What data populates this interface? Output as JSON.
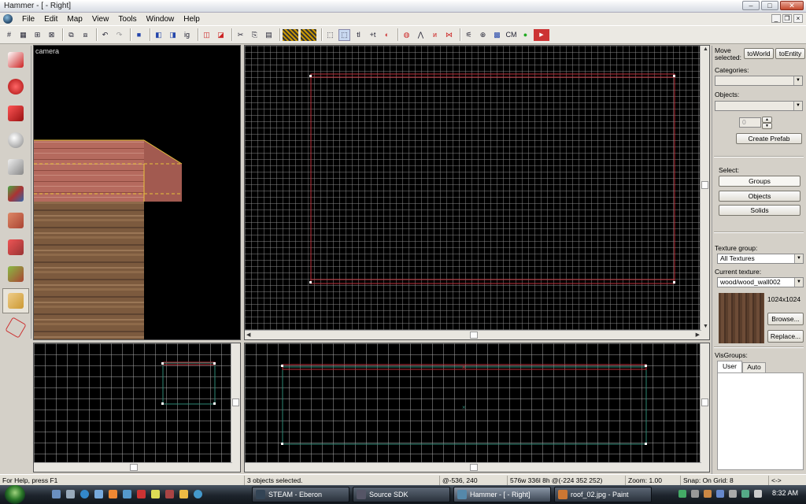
{
  "window": {
    "title": "Hammer - [ - Right]"
  },
  "menu": {
    "items": [
      "File",
      "Edit",
      "Map",
      "View",
      "Tools",
      "Window",
      "Help"
    ]
  },
  "toolbar": {
    "cm_label": "CM"
  },
  "viewports": {
    "camera_label": "camera"
  },
  "right_panel": {
    "move_selected_label": "Move selected:",
    "to_world": "toWorld",
    "to_entity": "toEntity",
    "categories_label": "Categories:",
    "objects_label": "Objects:",
    "count_value": "0",
    "create_prefab": "Create Prefab",
    "select_label": "Select:",
    "groups": "Groups",
    "objects_btn": "Objects",
    "solids": "Solids",
    "texture_group_label": "Texture group:",
    "texture_group_value": "All Textures",
    "current_texture_label": "Current texture:",
    "current_texture_value": "wood/wood_wall002",
    "texture_size": "1024x1024",
    "browse": "Browse...",
    "replace": "Replace...",
    "visgroups_label": "VisGroups:",
    "tab_user": "User",
    "tab_auto": "Auto"
  },
  "statusbar": {
    "help": "For Help, press F1",
    "selection": "3 objects selected.",
    "coords": "@-536, 240",
    "size": "576w 336l 8h @(-224 352 252)",
    "zoom": "Zoom: 1.00",
    "snap": "Snap: On Grid: 8",
    "nav": "<->"
  },
  "taskbar": {
    "tasks": [
      "STEAM - Eberon",
      "Source SDK",
      "Hammer - [ - Right]",
      "roof_02.jpg - Paint"
    ],
    "clock": "8:32 AM"
  }
}
